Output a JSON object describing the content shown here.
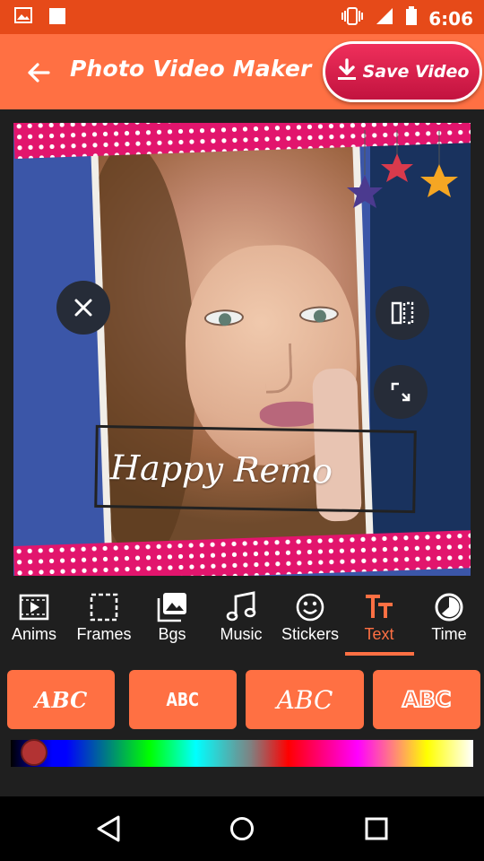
{
  "status_bar": {
    "time": "6:06",
    "left_icons": [
      "image-icon",
      "square-icon"
    ],
    "right_icons": [
      "vibrate-icon",
      "signal-icon",
      "battery-icon"
    ]
  },
  "app_bar": {
    "title": "Photo Video Maker",
    "save_label": "Save Video",
    "colors": {
      "bar": "#ff7043",
      "status": "#e64a19",
      "save": "#d81b4a"
    }
  },
  "canvas": {
    "overlay_text": "Happy Remo"
  },
  "toolbar": {
    "items": [
      {
        "label": "Anims",
        "icon": "film-play-icon",
        "active": false
      },
      {
        "label": "Frames",
        "icon": "frame-icon",
        "active": false
      },
      {
        "label": "Bgs",
        "icon": "gallery-icon",
        "active": false
      },
      {
        "label": "Music",
        "icon": "music-note-icon",
        "active": false
      },
      {
        "label": "Stickers",
        "icon": "smiley-icon",
        "active": false
      },
      {
        "label": "Text",
        "icon": "text-icon",
        "active": true
      },
      {
        "label": "Time",
        "icon": "timer-icon",
        "active": false
      }
    ]
  },
  "text_styles": [
    "ABC",
    "ABC",
    "ABC",
    "ABC"
  ],
  "color_slider": {
    "value": 0.05
  },
  "nav_bar": {
    "icons": [
      "back-triangle-icon",
      "home-circle-icon",
      "recents-square-icon"
    ]
  }
}
